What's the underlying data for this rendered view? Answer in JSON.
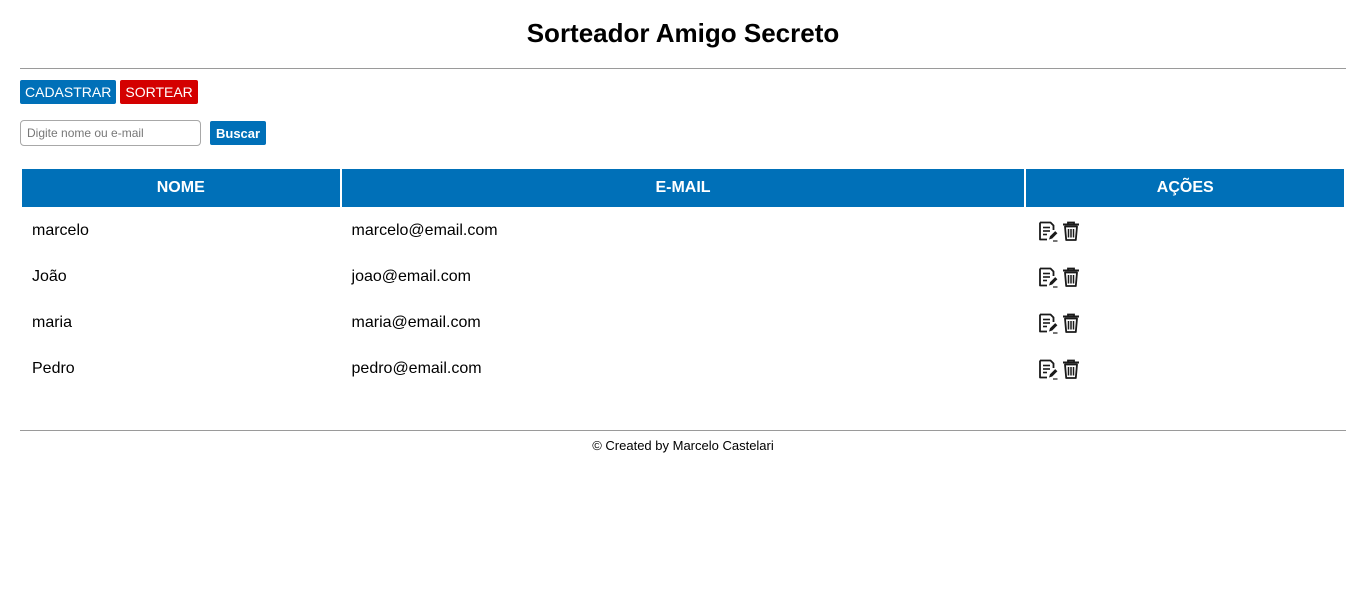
{
  "header": {
    "title": "Sorteador Amigo Secreto"
  },
  "toolbar": {
    "register_label": "CADASTRAR",
    "draw_label": "SORTEAR"
  },
  "search": {
    "placeholder": "Digite nome ou e-mail",
    "value": "",
    "button_label": "Buscar"
  },
  "table": {
    "columns": [
      "NOME",
      "E-MAIL",
      "AÇÕES"
    ],
    "rows": [
      {
        "name": "marcelo",
        "email": "marcelo@email.com"
      },
      {
        "name": "João",
        "email": "joao@email.com"
      },
      {
        "name": "maria",
        "email": "maria@email.com"
      },
      {
        "name": "Pedro",
        "email": "pedro@email.com"
      }
    ],
    "action_icons": [
      "edit-icon",
      "trash-icon"
    ]
  },
  "footer": {
    "text": "© Created by Marcelo Castelari"
  },
  "colors": {
    "primary": "#0070b8",
    "danger": "#d40000",
    "divider": "#9a9a9a"
  }
}
